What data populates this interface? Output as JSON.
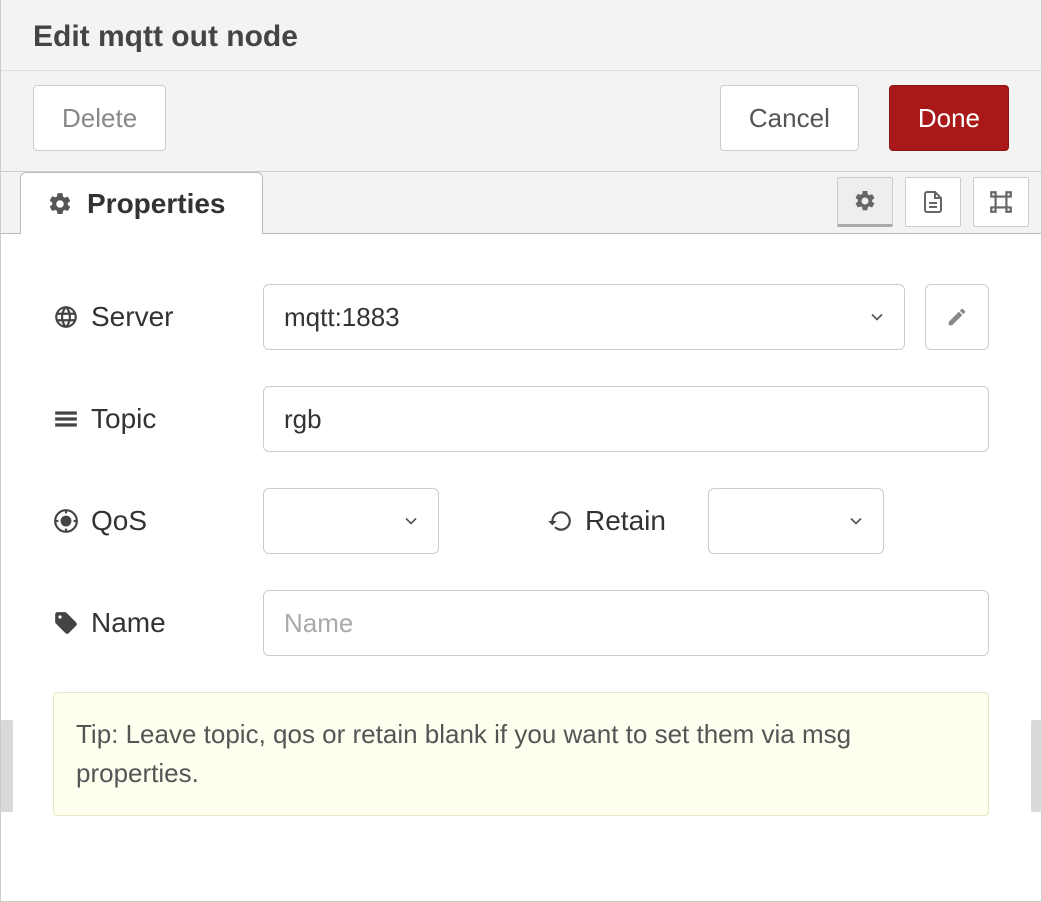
{
  "header": {
    "title": "Edit mqtt out node"
  },
  "toolbar": {
    "delete_label": "Delete",
    "cancel_label": "Cancel",
    "done_label": "Done"
  },
  "tabs": {
    "properties_label": "Properties"
  },
  "form": {
    "server": {
      "label": "Server",
      "value": "mqtt:1883"
    },
    "topic": {
      "label": "Topic",
      "value": "rgb"
    },
    "qos": {
      "label": "QoS",
      "value": ""
    },
    "retain": {
      "label": "Retain",
      "value": ""
    },
    "name": {
      "label": "Name",
      "value": "",
      "placeholder": "Name"
    }
  },
  "tip": "Tip: Leave topic, qos or retain blank if you want to set them via msg properties."
}
